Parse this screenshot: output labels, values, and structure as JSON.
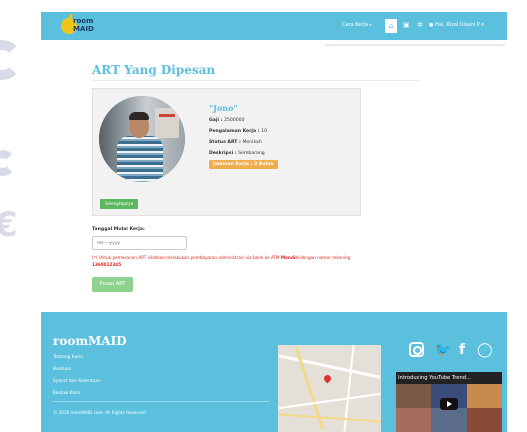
{
  "navbar": {
    "logo_line1": "room",
    "logo_line2": "MAID",
    "menu_label": "Cara Kerja",
    "home_icon": "home-icon",
    "user_label": "Hai, Rizal Ulsani P"
  },
  "page": {
    "title": "ART Yang Dipesan"
  },
  "card": {
    "name": "\"Jono\"",
    "salary_label": "Gaji : ",
    "salary_value": "2500000",
    "experience_label": "Pengalaman Kerja : ",
    "experience_value": "10",
    "status_label": "Status ART : ",
    "status_value": "Menikah",
    "description_label": "Deskripsi : ",
    "description_value": "Sembarang",
    "guarantee": "Jaminan Kerja : 3 Bulan",
    "detail_button": "Selengkapnya"
  },
  "form": {
    "date_label": "Tanggal Mulai Kerja:",
    "date_placeholder": "dd----yyyy",
    "notice_prefix": "(*) Untuk pemesanan ART silahkan melakukan pembayaran administrasi via bank ke ATM ",
    "notice_bank": "Mandiri",
    "notice_mid": " dengan nomor rekening ",
    "notice_account": "1360012345",
    "order_button": "Pesan ART"
  },
  "footer": {
    "brand": "roomMAID",
    "links": [
      "Tentang Kami",
      "Bantuan",
      "Syarat dan Ketentuan",
      "Kontak Kami"
    ],
    "copyright": "© 2016 roomMAID.com. All Rights Reserved",
    "video_title": "Introducing YouTube Trend..."
  },
  "colors": {
    "primary": "#5bc0de",
    "success": "#5cb85c",
    "warning": "#f0ad4e",
    "danger": "#e0261c"
  }
}
